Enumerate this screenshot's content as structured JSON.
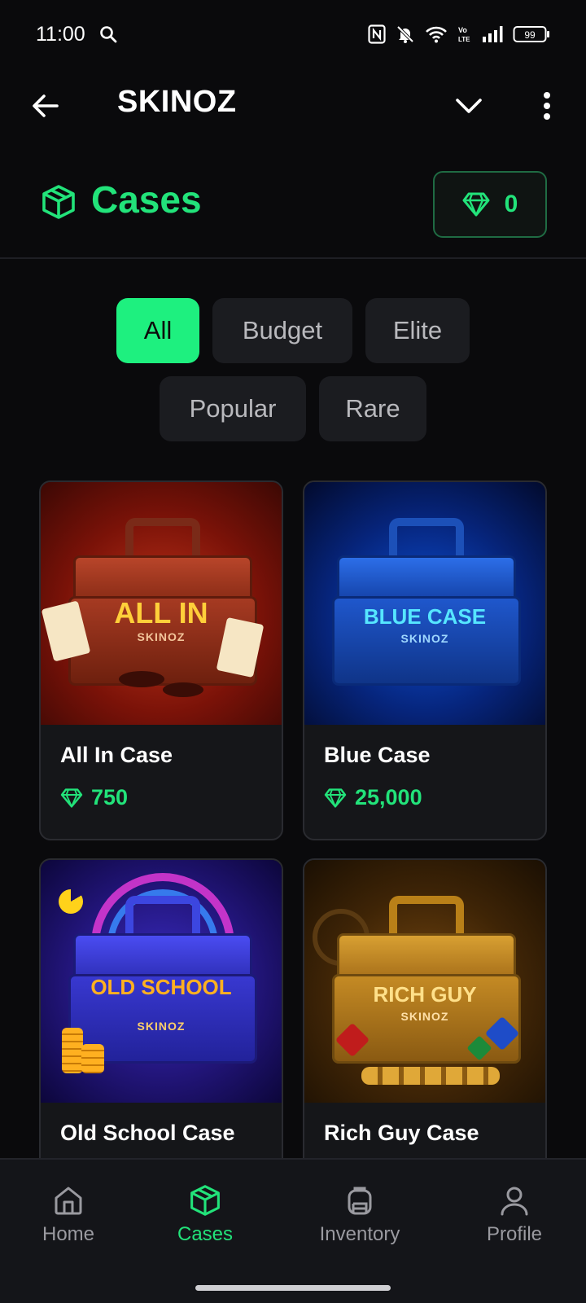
{
  "status_bar": {
    "time": "11:00",
    "battery": "99"
  },
  "app_bar": {
    "title": "SKINOZ"
  },
  "page_header": {
    "title": "Cases",
    "balance": "0"
  },
  "filters": [
    {
      "label": "All",
      "active": true
    },
    {
      "label": "Budget",
      "active": false
    },
    {
      "label": "Elite",
      "active": false
    },
    {
      "label": "Popular",
      "active": false
    },
    {
      "label": "Rare",
      "active": false
    }
  ],
  "cases": [
    {
      "name": "All In Case",
      "price": "750",
      "art_title": "ALL IN",
      "art_sub": "SKINOZ"
    },
    {
      "name": "Blue Case",
      "price": "25,000",
      "art_title": "BLUE CASE",
      "art_sub": "SKINOZ"
    },
    {
      "name": "Old School Case",
      "price": "",
      "art_title": "OLD SCHOOL",
      "art_sub": "SKINOZ"
    },
    {
      "name": "Rich Guy Case",
      "price": "",
      "art_title": "RICH GUY",
      "art_sub": "SKINOZ"
    }
  ],
  "bottom_nav": [
    {
      "label": "Home",
      "icon": "home-icon",
      "active": false
    },
    {
      "label": "Cases",
      "icon": "cube-icon",
      "active": true
    },
    {
      "label": "Inventory",
      "icon": "backpack-icon",
      "active": false
    },
    {
      "label": "Profile",
      "icon": "user-icon",
      "active": false
    }
  ],
  "colors": {
    "accent": "#22e37a",
    "background": "#0a0a0c",
    "chip": "#1b1c20",
    "card": "#151619"
  }
}
